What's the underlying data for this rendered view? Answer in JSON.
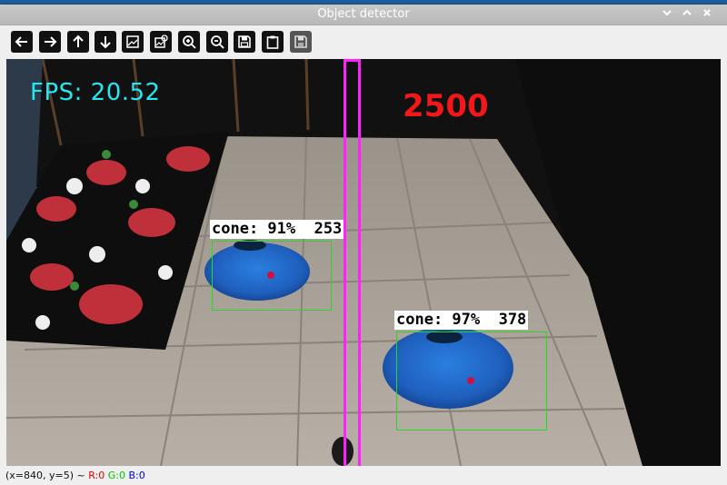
{
  "window": {
    "title": "Object detector"
  },
  "toolbar": {
    "buttons": [
      {
        "name": "pan-left-button",
        "icon": "arrow-left-icon"
      },
      {
        "name": "pan-right-button",
        "icon": "arrow-right-icon"
      },
      {
        "name": "pan-up-button",
        "icon": "arrow-up-icon"
      },
      {
        "name": "pan-down-button",
        "icon": "arrow-down-icon"
      },
      {
        "name": "zoom-fit-button",
        "icon": "image-icon"
      },
      {
        "name": "zoom-original-button",
        "icon": "image-zoom-icon"
      },
      {
        "name": "zoom-in-button",
        "icon": "zoom-in-icon"
      },
      {
        "name": "zoom-out-button",
        "icon": "zoom-out-icon"
      },
      {
        "name": "save-button",
        "icon": "save-icon"
      },
      {
        "name": "copy-clipboard-button",
        "icon": "clipboard-icon"
      },
      {
        "name": "properties-button",
        "icon": "properties-icon"
      }
    ]
  },
  "overlay": {
    "fps_text": "FPS: 20.52",
    "count_text": "2500",
    "fps_color": "#22e8f4",
    "count_color": "#f01818",
    "line_color": "#ff22ff",
    "box_color": "#2bd62b"
  },
  "detections": [
    {
      "label": "cone: 91%  253"
    },
    {
      "label": "cone: 97%  378"
    }
  ],
  "status": {
    "coords": "(x=840, y=5) ~ ",
    "r": "R:0",
    "g": "G:0",
    "b": "B:0"
  }
}
